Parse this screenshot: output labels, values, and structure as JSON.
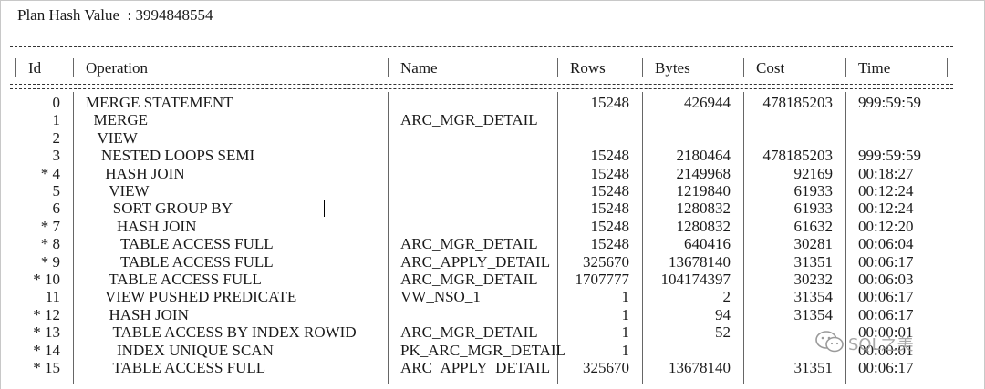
{
  "plan_hash": "Plan Hash Value  : 3994848554",
  "headers": {
    "id": "Id",
    "operation": "Operation",
    "name": "Name",
    "rows": "Rows",
    "bytes": "Bytes",
    "cost": "Cost",
    "time": "Time"
  },
  "plan_rows": [
    {
      "id": "0",
      "operation": "MERGE STATEMENT",
      "name": "",
      "rows": "15248",
      "bytes": "426944",
      "cost": "478185203",
      "time": "999:59:59"
    },
    {
      "id": "1",
      "operation": "  MERGE",
      "name": "ARC_MGR_DETAIL",
      "rows": "",
      "bytes": "",
      "cost": "",
      "time": ""
    },
    {
      "id": "2",
      "operation": "   VIEW",
      "name": "",
      "rows": "",
      "bytes": "",
      "cost": "",
      "time": ""
    },
    {
      "id": "3",
      "operation": "    NESTED LOOPS SEMI",
      "name": "",
      "rows": "15248",
      "bytes": "2180464",
      "cost": "478185203",
      "time": "999:59:59"
    },
    {
      "id": "* 4",
      "operation": "     HASH JOIN",
      "name": "",
      "rows": "15248",
      "bytes": "2149968",
      "cost": "92169",
      "time": "00:18:27"
    },
    {
      "id": "5",
      "operation": "      VIEW",
      "name": "",
      "rows": "15248",
      "bytes": "1219840",
      "cost": "61933",
      "time": "00:12:24"
    },
    {
      "id": "6",
      "operation": "       SORT GROUP BY",
      "name": "",
      "rows": "15248",
      "bytes": "1280832",
      "cost": "61933",
      "time": "00:12:24"
    },
    {
      "id": "* 7",
      "operation": "        HASH JOIN",
      "name": "",
      "rows": "15248",
      "bytes": "1280832",
      "cost": "61632",
      "time": "00:12:20"
    },
    {
      "id": "* 8",
      "operation": "         TABLE ACCESS FULL",
      "name": "ARC_MGR_DETAIL",
      "rows": "15248",
      "bytes": "640416",
      "cost": "30281",
      "time": "00:06:04"
    },
    {
      "id": "* 9",
      "operation": "         TABLE ACCESS FULL",
      "name": "ARC_APPLY_DETAIL",
      "rows": "325670",
      "bytes": "13678140",
      "cost": "31351",
      "time": "00:06:17"
    },
    {
      "id": "* 10",
      "operation": "      TABLE ACCESS FULL",
      "name": "ARC_MGR_DETAIL",
      "rows": "1707777",
      "bytes": "104174397",
      "cost": "30232",
      "time": "00:06:03"
    },
    {
      "id": "11",
      "operation": "     VIEW PUSHED PREDICATE",
      "name": "VW_NSO_1",
      "rows": "1",
      "bytes": "2",
      "cost": "31354",
      "time": "00:06:17"
    },
    {
      "id": "* 12",
      "operation": "      HASH JOIN",
      "name": "",
      "rows": "1",
      "bytes": "94",
      "cost": "31354",
      "time": "00:06:17"
    },
    {
      "id": "* 13",
      "operation": "       TABLE ACCESS BY INDEX ROWID",
      "name": "ARC_MGR_DETAIL",
      "rows": "1",
      "bytes": "52",
      "cost": "",
      "time": "00:00:01"
    },
    {
      "id": "* 14",
      "operation": "        INDEX UNIQUE SCAN",
      "name": "PK_ARC_MGR_DETAIL",
      "rows": "1",
      "bytes": "",
      "cost": "",
      "time": "00:00:01"
    },
    {
      "id": "* 15",
      "operation": "       TABLE ACCESS FULL",
      "name": "ARC_APPLY_DETAIL",
      "rows": "325670",
      "bytes": "13678140",
      "cost": "31351",
      "time": "00:06:17"
    }
  ],
  "watermark": "SQL之美",
  "watermark_icon": "wechat-icon"
}
